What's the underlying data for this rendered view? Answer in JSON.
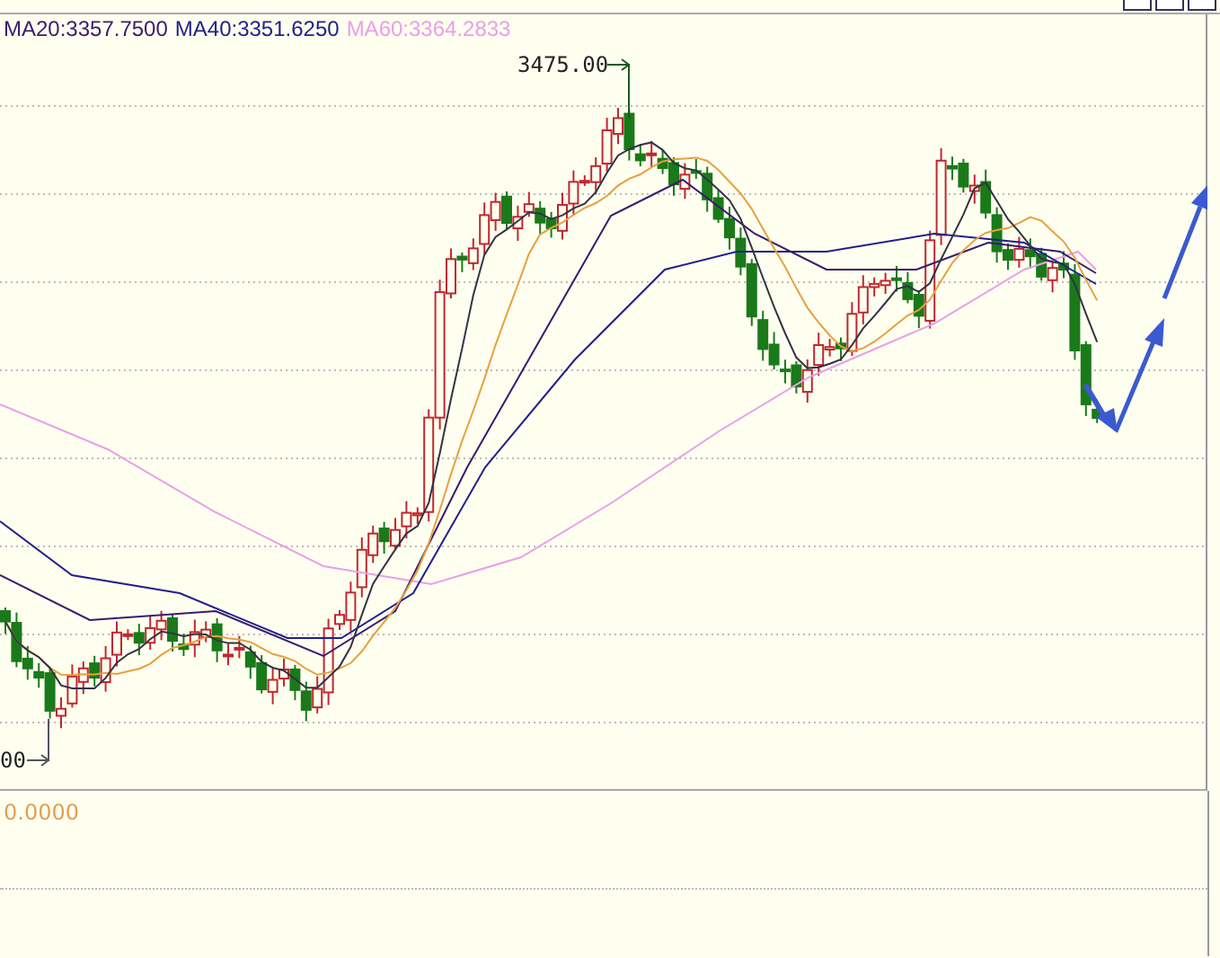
{
  "legend": [
    {
      "label": "MA20:3357.7500",
      "color": "#3a1a6e"
    },
    {
      "label": "MA40:3351.6250",
      "color": "#20208e"
    },
    {
      "label": "MA60:3364.2833",
      "color": "#e8a0e8"
    }
  ],
  "price_chart": {
    "high_marker": "3475.00",
    "low_marker": "00"
  },
  "lower_panel": {
    "reading": "0.0000"
  }
}
